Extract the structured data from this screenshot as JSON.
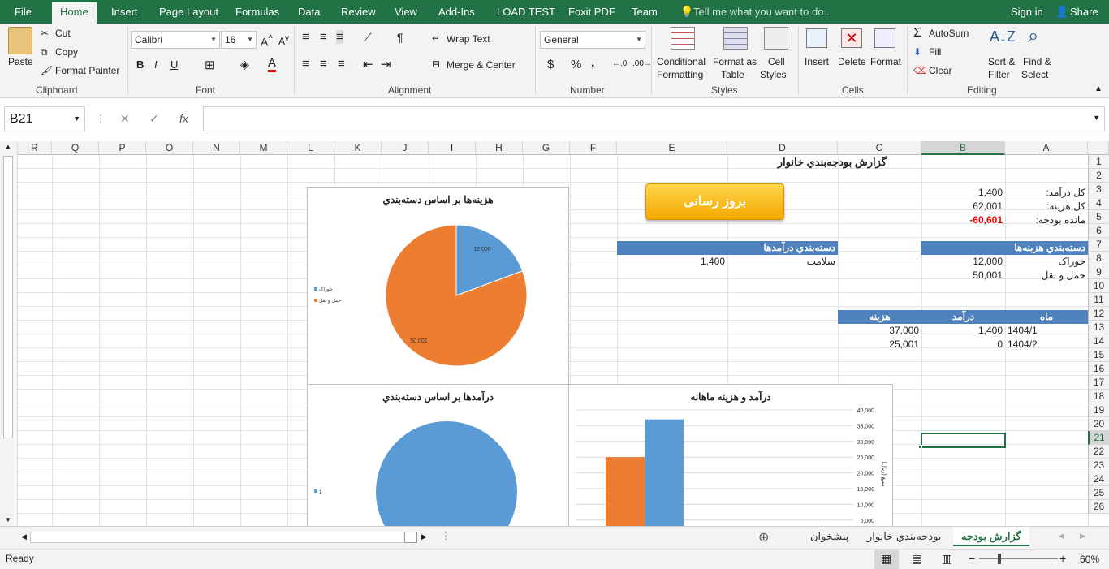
{
  "ribbon_tabs": [
    "File",
    "Home",
    "Insert",
    "Page Layout",
    "Formulas",
    "Data",
    "Review",
    "View",
    "Add-Ins",
    "LOAD TEST",
    "Foxit PDF",
    "Team"
  ],
  "tell_me": "Tell me what you want to do...",
  "sign_in": "Sign in",
  "share": "Share",
  "clipboard": {
    "paste": "Paste",
    "cut": "Cut",
    "copy": "Copy",
    "format_painter": "Format Painter",
    "group": "Clipboard"
  },
  "font": {
    "name": "Calibri",
    "size": "16",
    "bold": "B",
    "italic": "I",
    "underline": "U",
    "group": "Font"
  },
  "alignment": {
    "wrap": "Wrap Text",
    "merge": "Merge & Center",
    "group": "Alignment"
  },
  "number": {
    "format": "General",
    "currency": "$",
    "percent": "%",
    "comma": ",",
    "group": "Number"
  },
  "styles": {
    "conditional": "Conditional",
    "formatting": "Formatting",
    "format_as": "Format as",
    "table": "Table",
    "cell": "Cell",
    "cell_styles": "Styles",
    "group": "Styles"
  },
  "cells": {
    "insert": "Insert",
    "delete": "Delete",
    "format": "Format",
    "group": "Cells"
  },
  "editing": {
    "autosum": "AutoSum",
    "fill": "Fill",
    "clear": "Clear",
    "sort": "Sort &",
    "filter": "Filter",
    "find": "Find &",
    "select": "Select",
    "group": "Editing"
  },
  "formula_bar": {
    "name_box": "B21",
    "fx": "fx",
    "cancel": "✕",
    "enter": "✓",
    "value": ""
  },
  "columns": [
    "R",
    "Q",
    "P",
    "O",
    "N",
    "M",
    "L",
    "K",
    "J",
    "I",
    "H",
    "G",
    "F",
    "E",
    "D",
    "C",
    "B",
    "A"
  ],
  "rows": [
    "1",
    "2",
    "3",
    "4",
    "5",
    "6",
    "7",
    "8",
    "9",
    "10",
    "11",
    "12",
    "13",
    "14",
    "15",
    "16",
    "17",
    "18",
    "19",
    "20",
    "21",
    "22",
    "23",
    "24",
    "25",
    "26"
  ],
  "sheet": {
    "title": "گزارش بودجه‌بندي خانوار",
    "total_income_label": "کل درآمد:",
    "total_income": "1,400",
    "total_expense_label": "کل هزینه:",
    "total_expense": "62,001",
    "balance_label": "مانده بودجه:",
    "balance": "-60,601",
    "expense_cat_header": "دسته‌بندي هزینه‌ها",
    "income_cat_header": "دسته‌بندي درآمدها",
    "exp_rows": [
      {
        "name": "خوراک",
        "value": "12,000"
      },
      {
        "name": "حمل و نقل",
        "value": "50,001"
      }
    ],
    "inc_rows": [
      {
        "name": "سلامت",
        "value": "1,400"
      }
    ],
    "monthly_header": {
      "month": "ماه",
      "income": "درآمد",
      "expense": "هزینه"
    },
    "monthly_rows": [
      {
        "month": "1404/1",
        "income": "1,400",
        "expense": "37,000"
      },
      {
        "month": "1404/2",
        "income": "0",
        "expense": "25,001"
      }
    ],
    "update_button": "بروز رسانی"
  },
  "charts": {
    "pie1": {
      "title": "هزینه‌ها بر اساس دسته‌بندي",
      "legend": [
        "خوراک",
        "حمل و نقل"
      ]
    },
    "pie2": {
      "title": "درآمدها بر اساس دسته‌بندي",
      "legend": [
        "1"
      ]
    },
    "bar": {
      "title": "درآمد و هزینه ماهانه",
      "ylabel": "مبلغ (ریال)"
    }
  },
  "chart_data": [
    {
      "type": "pie",
      "title": "هزینه‌ها بر اساس دسته‌بندي",
      "categories": [
        "خوراک",
        "حمل و نقل"
      ],
      "values": [
        12000,
        50001
      ],
      "data_labels": [
        "12,000",
        "50,001"
      ],
      "colors": [
        "#5b9bd5",
        "#ed7d31"
      ],
      "legend_placement": "left"
    },
    {
      "type": "pie",
      "title": "درآمدها بر اساس دسته‌بندي",
      "categories": [
        "1"
      ],
      "values": [
        1400
      ],
      "colors": [
        "#5b9bd5"
      ],
      "legend_placement": "left"
    },
    {
      "type": "bar",
      "title": "درآمد و هزینه ماهانه",
      "ylabel": "مبلغ (ریال)",
      "ylim": [
        0,
        40000
      ],
      "y_ticks": [
        "40,000",
        "35,000",
        "30,000",
        "25,000",
        "20,000",
        "15,000",
        "10,000",
        "5,000"
      ],
      "bars": [
        {
          "value": 25001,
          "color": "#ed7d31"
        },
        {
          "value": 37000,
          "color": "#5b9bd5"
        }
      ],
      "grid": true
    }
  ],
  "sheet_tabs": [
    "گزارش بودجه",
    "بودجه‌بندي خانوار",
    "پیشخوان"
  ],
  "status": {
    "ready": "Ready",
    "zoom": "60%"
  },
  "colors": {
    "excel_green": "#217346",
    "header_blue": "#4f81bd",
    "negative": "#ff0000",
    "button_gold": "#f5a800"
  }
}
